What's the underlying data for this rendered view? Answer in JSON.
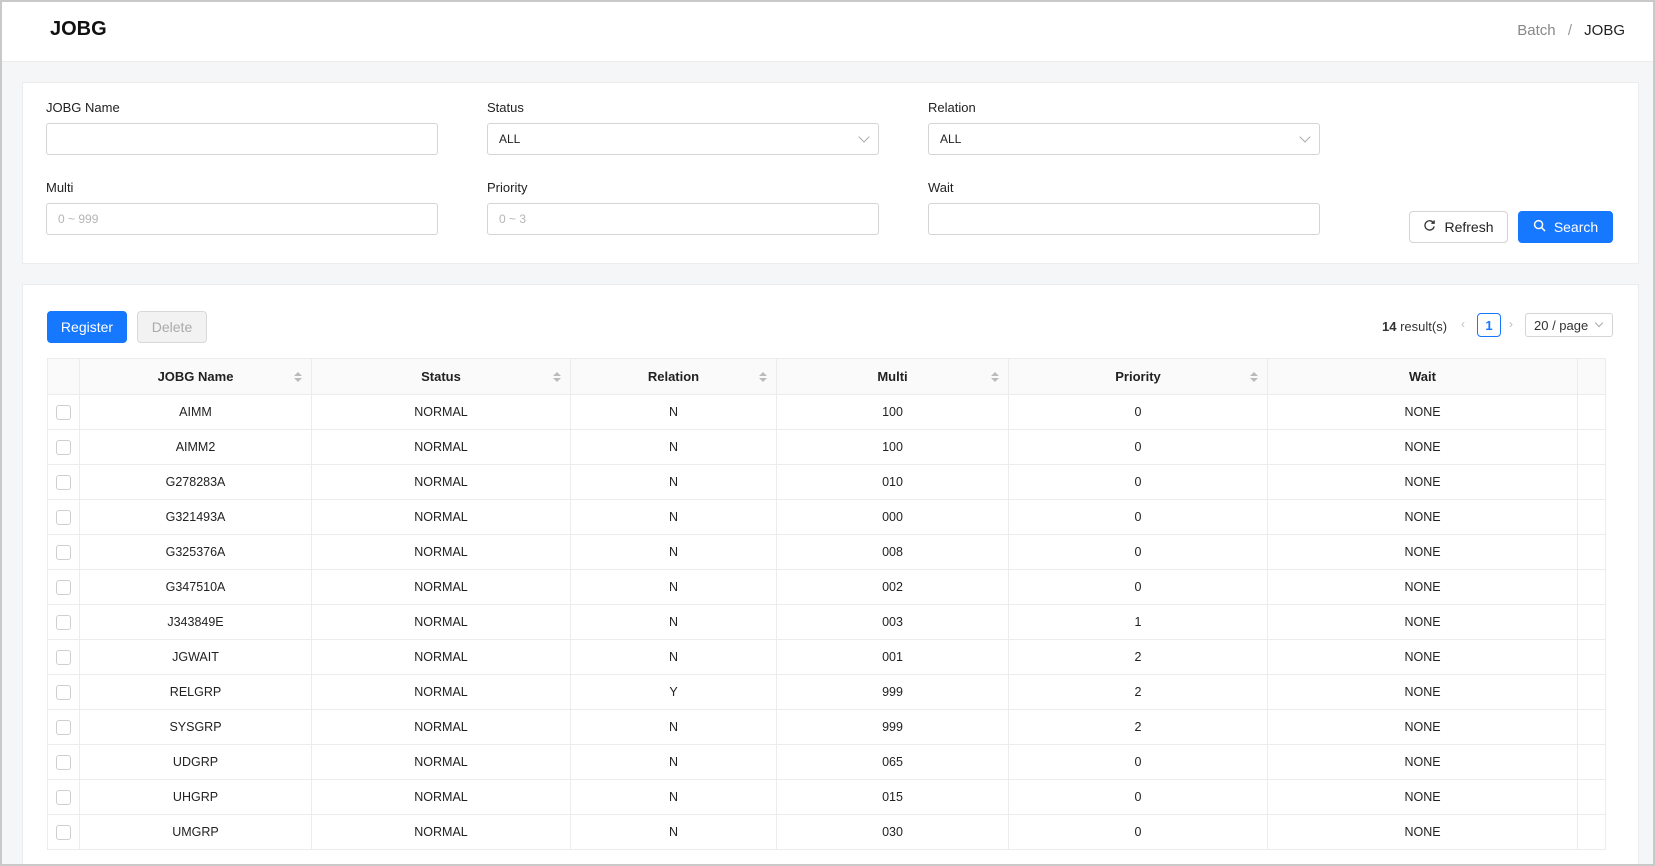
{
  "header": {
    "title": "JOBG",
    "breadcrumb": [
      "Batch",
      "JOBG"
    ]
  },
  "filters": {
    "jobg_name": {
      "label": "JOBG Name",
      "value": "",
      "placeholder": ""
    },
    "status": {
      "label": "Status",
      "value": "ALL"
    },
    "relation": {
      "label": "Relation",
      "value": "ALL"
    },
    "multi": {
      "label": "Multi",
      "value": "",
      "placeholder": "0 ~ 999"
    },
    "priority": {
      "label": "Priority",
      "value": "",
      "placeholder": "0 ~ 3"
    },
    "wait": {
      "label": "Wait",
      "value": "",
      "placeholder": ""
    },
    "refresh_label": "Refresh",
    "search_label": "Search"
  },
  "toolbar": {
    "register_label": "Register",
    "delete_label": "Delete",
    "result_count": "14",
    "result_suffix": "result(s)",
    "current_page": "1",
    "page_size": "20 / page"
  },
  "table": {
    "columns": [
      "JOBG Name",
      "Status",
      "Relation",
      "Multi",
      "Priority",
      "Wait"
    ],
    "rows": [
      [
        "AIMM",
        "NORMAL",
        "N",
        "100",
        "0",
        "NONE"
      ],
      [
        "AIMM2",
        "NORMAL",
        "N",
        "100",
        "0",
        "NONE"
      ],
      [
        "G278283A",
        "NORMAL",
        "N",
        "010",
        "0",
        "NONE"
      ],
      [
        "G321493A",
        "NORMAL",
        "N",
        "000",
        "0",
        "NONE"
      ],
      [
        "G325376A",
        "NORMAL",
        "N",
        "008",
        "0",
        "NONE"
      ],
      [
        "G347510A",
        "NORMAL",
        "N",
        "002",
        "0",
        "NONE"
      ],
      [
        "J343849E",
        "NORMAL",
        "N",
        "003",
        "1",
        "NONE"
      ],
      [
        "JGWAIT",
        "NORMAL",
        "N",
        "001",
        "2",
        "NONE"
      ],
      [
        "RELGRP",
        "NORMAL",
        "Y",
        "999",
        "2",
        "NONE"
      ],
      [
        "SYSGRP",
        "NORMAL",
        "N",
        "999",
        "2",
        "NONE"
      ],
      [
        "UDGRP",
        "NORMAL",
        "N",
        "065",
        "0",
        "NONE"
      ],
      [
        "UHGRP",
        "NORMAL",
        "N",
        "015",
        "0",
        "NONE"
      ],
      [
        "UMGRP",
        "NORMAL",
        "N",
        "030",
        "0",
        "NONE"
      ]
    ]
  },
  "colors": {
    "primary": "#1677ff",
    "link": "#1677ff"
  }
}
